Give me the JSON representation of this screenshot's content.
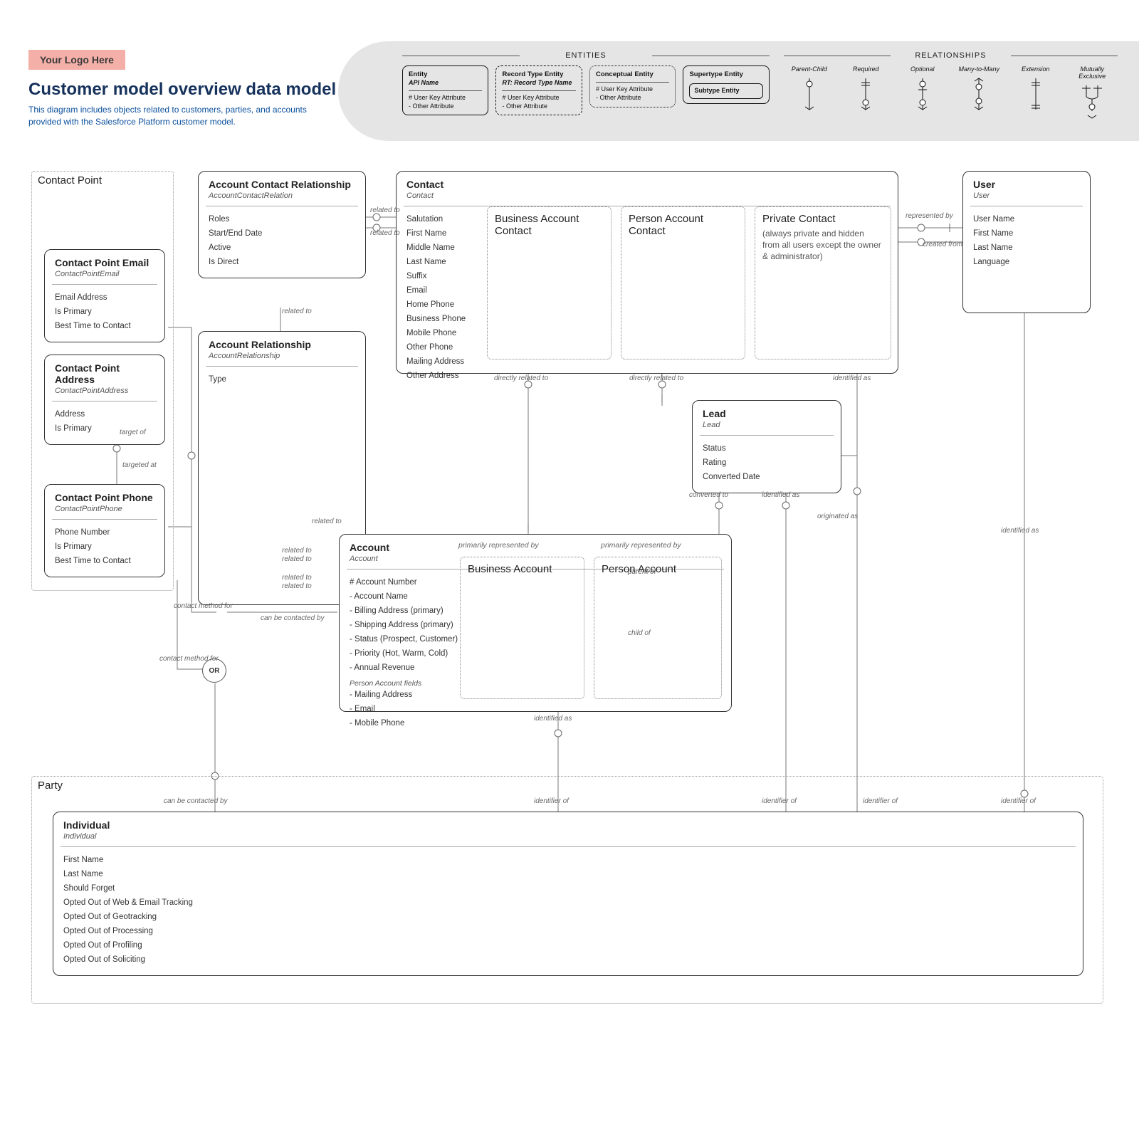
{
  "header": {
    "logo": "Your Logo Here",
    "title": "Customer model overview data model",
    "subtitle": "This diagram includes objects related to customers, parties, and accounts provided with the Salesforce Platform customer model."
  },
  "legend": {
    "entities_heading": "ENTITIES",
    "relationships_heading": "RELATIONSHIPS",
    "entity_examples": {
      "solid": {
        "title": "Entity",
        "subtitle": "API Name",
        "lines": [
          "# User Key Attribute",
          "- Other Attribute"
        ]
      },
      "dashed": {
        "title": "Record Type Entity",
        "subtitle": "RT: Record Type Name",
        "lines": [
          "# User Key Attribute",
          "- Other Attribute"
        ]
      },
      "dotted": {
        "title": "Conceptual Entity",
        "lines": [
          "# User Key Attribute",
          "- Other Attribute"
        ]
      },
      "supertype": {
        "title": "Supertype Entity",
        "sub": "Subtype Entity"
      }
    },
    "relationships": [
      "Parent-Child",
      "Required",
      "Optional",
      "Many-to-Many",
      "Extension",
      "Mutually Exclusive"
    ]
  },
  "groups": {
    "contact_point": "Contact Point",
    "party": "Party"
  },
  "entities": {
    "cp_email": {
      "name": "Contact Point Email",
      "api": "ContactPointEmail",
      "attrs": [
        "Email Address",
        "Is Primary",
        "Best Time to Contact"
      ]
    },
    "cp_address": {
      "name": "Contact Point Address",
      "api": "ContactPointAddress",
      "attrs": [
        "Address",
        "Is Primary"
      ]
    },
    "cp_phone": {
      "name": "Contact Point Phone",
      "api": "ContactPointPhone",
      "attrs": [
        "Phone Number",
        "Is Primary",
        "Best Time to Contact"
      ]
    },
    "acr": {
      "name": "Account Contact Relationship",
      "api": "AccountContactRelation",
      "attrs": [
        "Roles",
        "Start/End Date",
        "Active",
        "Is Direct"
      ]
    },
    "ar": {
      "name": "Account Relationship",
      "api": "AccountRelationship",
      "attrs": [
        "Type"
      ]
    },
    "contact": {
      "name": "Contact",
      "api": "Contact",
      "attrs": [
        "Salutation",
        "First Name",
        "Middle Name",
        "Last Name",
        "Suffix",
        "Email",
        "Home Phone",
        "Business Phone",
        "Mobile Phone",
        "Other Phone",
        "Mailing Address",
        "Other Address"
      ]
    },
    "bac": {
      "name": "Business Account Contact"
    },
    "pac": {
      "name": "Person Account Contact"
    },
    "prc": {
      "name": "Private Contact",
      "desc": "(always private and hidden from all users except the owner & administrator)"
    },
    "user": {
      "name": "User",
      "api": "User",
      "attrs": [
        "User Name",
        "First Name",
        "Last Name",
        "Language"
      ]
    },
    "lead": {
      "name": "Lead",
      "api": "Lead",
      "attrs": [
        "Status",
        "Rating",
        "Converted Date"
      ]
    },
    "account": {
      "name": "Account",
      "api": "Account",
      "top_note": "primarily represented by",
      "attrs": [
        "# Account Number",
        "- Account Name",
        "- Billing Address (primary)",
        "- Shipping Address (primary)",
        "- Status (Prospect, Customer)",
        "- Priority (Hot, Warm, Cold)",
        "- Annual Revenue"
      ],
      "section": "Person Account fields",
      "attrs2": [
        "- Mailing Address",
        "- Email",
        "- Mobile Phone"
      ]
    },
    "ba": {
      "name": "Business Account"
    },
    "pa": {
      "name": "Person Account"
    },
    "individual": {
      "name": "Individual",
      "api": "Individual",
      "attrs": [
        "First Name",
        "Last Name",
        "Should Forget",
        "Opted Out of Web & Email Tracking",
        "Opted Out of Geotracking",
        "Opted Out of Processing",
        "Opted Out of Profiling",
        "Opted Out of Soliciting"
      ]
    }
  },
  "labels": {
    "related_to": "related to",
    "target_of": "target of",
    "targeted_at": "targeted at",
    "contact_method_for": "contact method for",
    "can_be_contacted_by": "can be contacted by",
    "directly_related_to": "directly related to",
    "represented_by": "represented by",
    "created_from": "created from",
    "identified_as": "identified as",
    "converted_to": "converted to",
    "originated_as": "originated as",
    "identifier_of": "identifier of",
    "primarily_represented_by": "primarily represented by",
    "parent_of": "parent of",
    "child_of": "child of",
    "or": "OR"
  }
}
